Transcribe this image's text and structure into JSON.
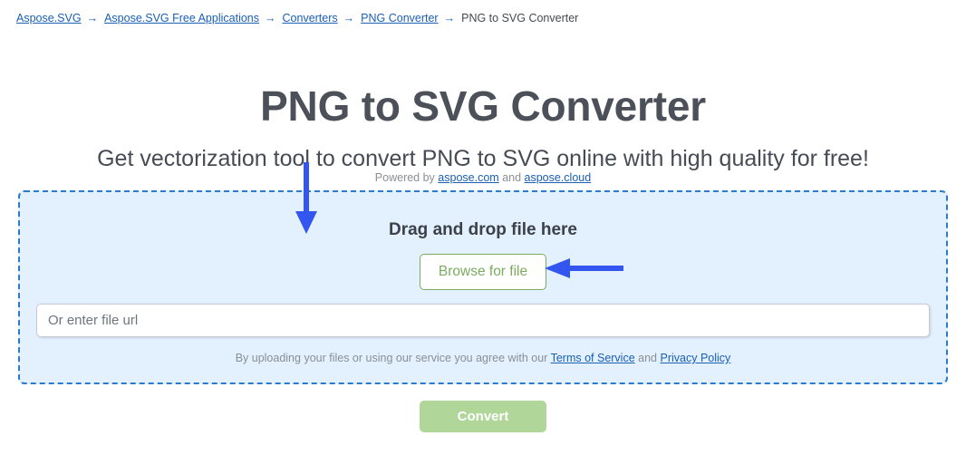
{
  "breadcrumb": {
    "separator": "→",
    "items": [
      {
        "label": "Aspose.SVG",
        "is_link": true
      },
      {
        "label": "Aspose.SVG Free Applications",
        "is_link": true
      },
      {
        "label": "Converters",
        "is_link": true
      },
      {
        "label": "PNG Converter",
        "is_link": true
      },
      {
        "label": "PNG to SVG Converter",
        "is_link": false
      }
    ]
  },
  "header": {
    "title": "PNG to SVG Converter",
    "subtitle": "Get vectorization tool to convert PNG to SVG online with high quality for free!",
    "powered_by_prefix": "Powered by",
    "powered_by_link1": "aspose.com",
    "powered_by_conjunction": "and",
    "powered_by_link2": "aspose.cloud"
  },
  "dropzone": {
    "title": "Drag and drop file here",
    "browse_label": "Browse for file",
    "url_placeholder": "Or enter file url",
    "url_value": "",
    "legal_prefix": "By uploading your files or using our service you agree with our",
    "legal_link1": "Terms of Service",
    "legal_conjunction": "and",
    "legal_link2": "Privacy Policy"
  },
  "actions": {
    "convert_label": "Convert"
  },
  "annotations": [
    {
      "name": "down-arrow",
      "direction": "down",
      "color": "#3355f0"
    },
    {
      "name": "left-arrow",
      "direction": "left",
      "color": "#3355f0"
    }
  ],
  "colors": {
    "link": "#1a5fb4",
    "title": "#4b5059",
    "dropzone_bg": "#e3f0fd",
    "dropzone_border": "#2c7ac9",
    "browse_border": "#7aab5e",
    "convert_bg": "#b1d69a",
    "annotation": "#3355f0"
  }
}
